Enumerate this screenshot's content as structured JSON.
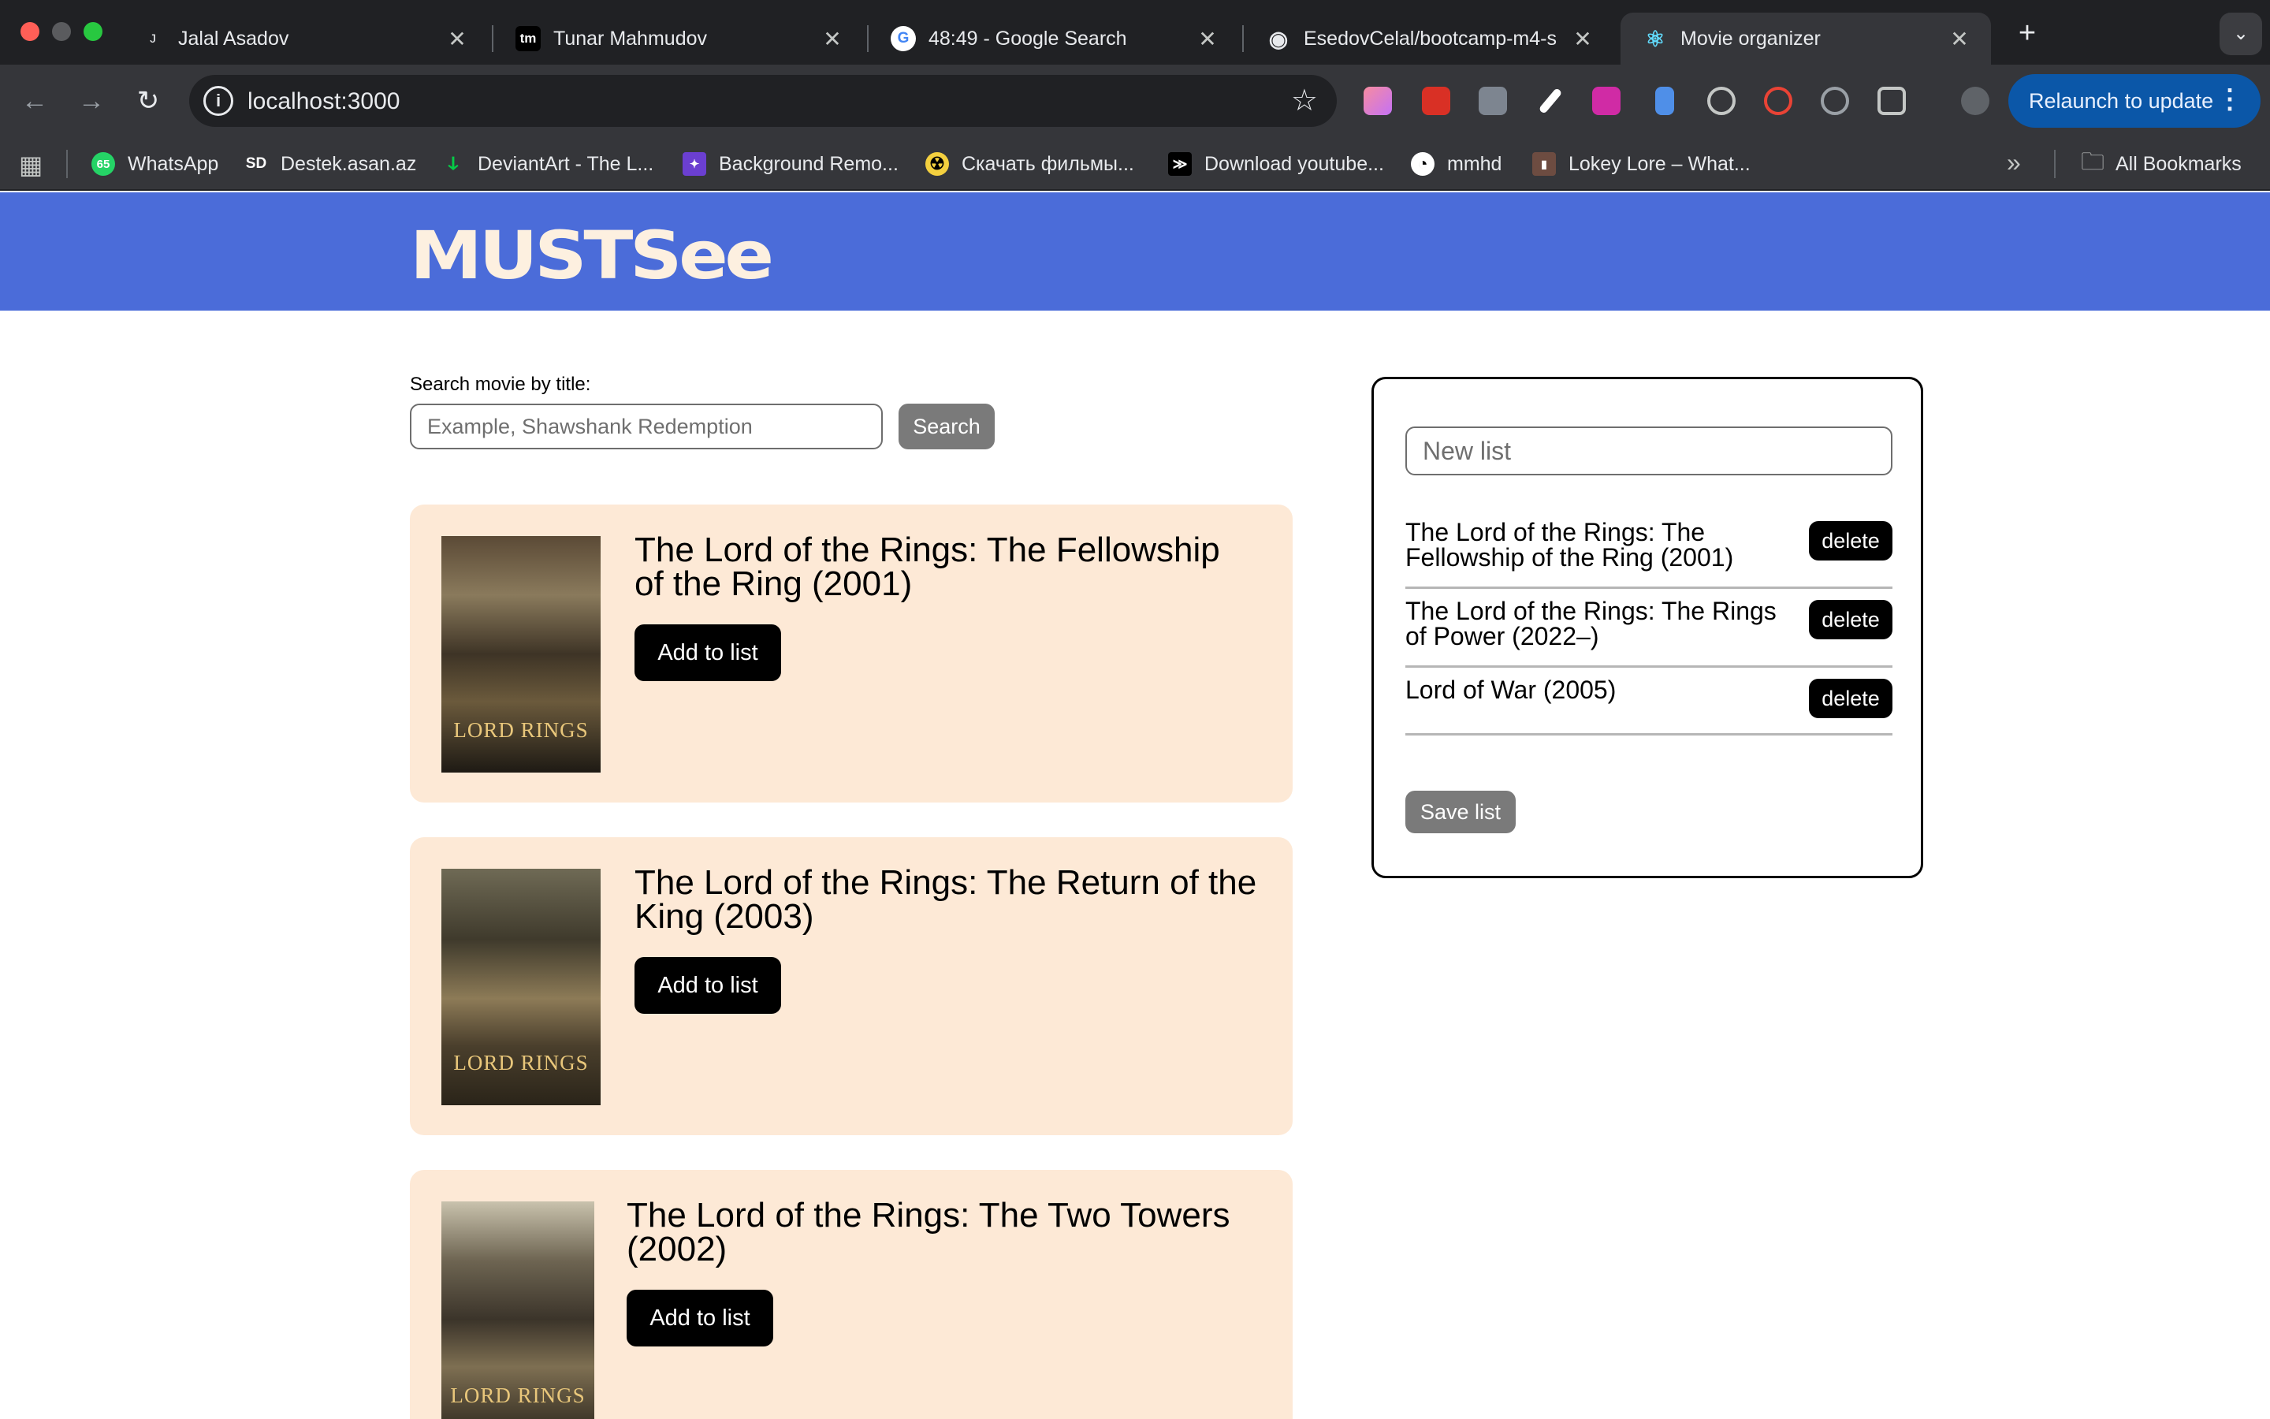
{
  "browser": {
    "tabs": [
      {
        "title": "Jalal Asadov",
        "favicon": "jalal-favicon",
        "favicon_glyph": "ᴊ"
      },
      {
        "title": "Tunar Mahmudov",
        "favicon": "tm-favicon",
        "favicon_glyph": "tm"
      },
      {
        "title": "48:49 - Google Search",
        "favicon": "google-icon",
        "favicon_glyph": "G"
      },
      {
        "title": "EsedovCelal/bootcamp-m4-s",
        "favicon": "github-icon",
        "favicon_glyph": "◉"
      },
      {
        "title": "Movie organizer",
        "favicon": "react-icon",
        "favicon_glyph": "⚛",
        "active": true
      }
    ],
    "new_tab_glyph": "+",
    "tab_search_glyph": "⌄",
    "close_glyph": "✕",
    "url": "localhost:3000",
    "relaunch_label": "Relaunch to update",
    "bookmarks": [
      {
        "label": "WhatsApp",
        "icon": "whatsapp-icon",
        "glyph": "65"
      },
      {
        "label": "Destek.asan.az",
        "icon": "sd-icon",
        "glyph": "SD"
      },
      {
        "label": "DeviantArt - The L...",
        "icon": "deviantart-icon",
        "glyph": "ↆ"
      },
      {
        "label": "Background Remo...",
        "icon": "background-remover-icon",
        "glyph": "✦"
      },
      {
        "label": "Скачать фильмы...",
        "icon": "film-icon",
        "glyph": "☢"
      },
      {
        "label": "Download youtube...",
        "icon": "terminal-icon",
        "glyph": "≫"
      },
      {
        "label": "mmhd",
        "icon": "mmhd-icon",
        "glyph": "◔"
      },
      {
        "label": "Lokey Lore – What...",
        "icon": "lokey-icon",
        "glyph": "▮"
      }
    ],
    "all_bookmarks_label": "All Bookmarks"
  },
  "site": {
    "logo_text": "MUSTSee"
  },
  "search": {
    "label": "Search movie by title:",
    "placeholder": "Example, Shawshank Redemption",
    "button_label": "Search"
  },
  "movies": [
    {
      "title": "The Lord of the Rings: The Fellowship of the Ring (2001)",
      "poster_text": "LORD RINGS",
      "add_label": "Add to list"
    },
    {
      "title": "The Lord of the Rings: The Return of the King (2003)",
      "poster_text": "LORD RINGS",
      "add_label": "Add to list"
    },
    {
      "title": "The Lord of the Rings: The Two Towers (2002)",
      "poster_text": "LORD RINGS",
      "add_label": "Add to list"
    }
  ],
  "list_panel": {
    "input_placeholder": "New list",
    "items": [
      {
        "title": "The Lord of the Rings: The Fellowship of the Ring (2001)",
        "delete_label": "delete"
      },
      {
        "title": "The Lord of the Rings: The Rings of Power (2022–)",
        "delete_label": "delete"
      },
      {
        "title": "Lord of War (2005)",
        "delete_label": "delete"
      }
    ],
    "save_label": "Save list"
  },
  "colors": {
    "header_blue": "#4b6cd9",
    "card_bg": "#fde9d6",
    "logo": "#fdf0e0",
    "relaunch": "#0b57a8",
    "chrome_dark": "#202124",
    "chrome_mid": "#35363a"
  }
}
